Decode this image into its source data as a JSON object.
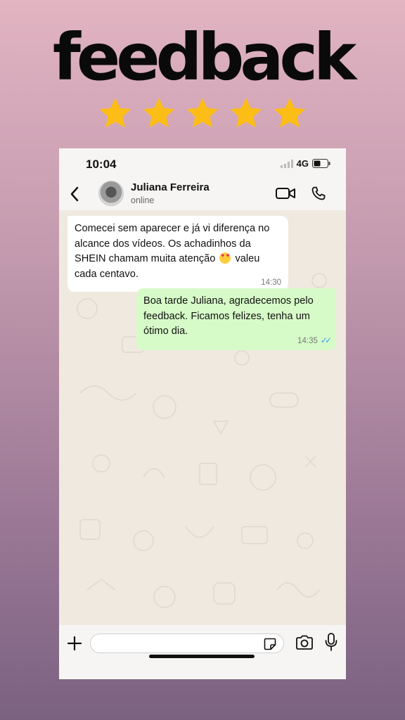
{
  "banner": {
    "title": "feedback",
    "star_count": 5,
    "star_color": "#fcbd17"
  },
  "status_bar": {
    "time": "10:04",
    "network": "4G"
  },
  "chat_header": {
    "contact_name": "Juliana Ferreira",
    "contact_status": "online"
  },
  "messages": {
    "incoming": {
      "text_before_emoji": "Comecei sem aparecer e já vi diferença no alcance dos vídeos. Os achadinhos da SHEIN chamam muita atenção",
      "emoji": "smiling-face-with-heart-eyes",
      "text_after_emoji": "valeu cada centavo.",
      "time": "14:30"
    },
    "outgoing": {
      "text": "Boa tarde Juliana, agradecemos pelo feedback. Ficamos felizes, tenha um ótimo dia.",
      "time": "14:35",
      "read_receipt": "double-check-icon",
      "receipt_color": "#3a9ee8"
    }
  },
  "colors": {
    "incoming_bubble": "#ffffff",
    "outgoing_bubble": "#d7fbc8",
    "chat_background": "#efe9df"
  }
}
